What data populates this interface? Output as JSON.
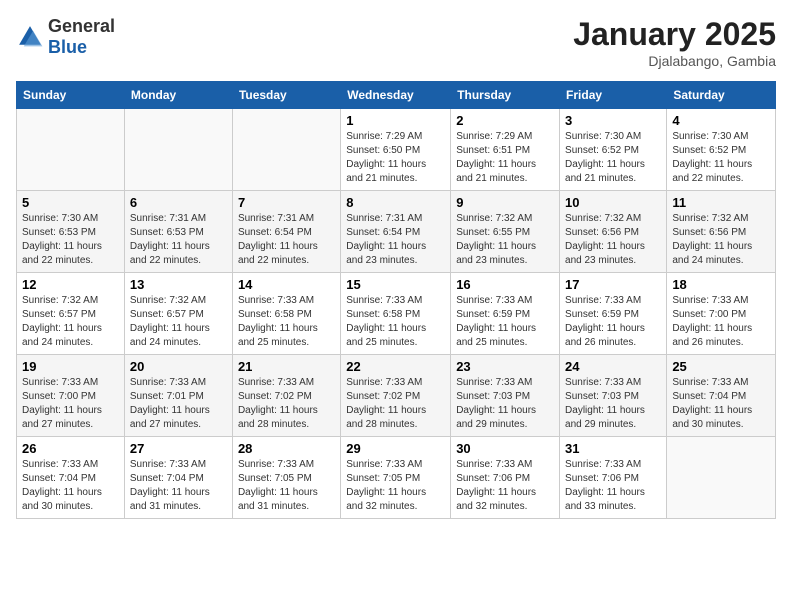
{
  "header": {
    "logo_general": "General",
    "logo_blue": "Blue",
    "month_title": "January 2025",
    "location": "Djalabango, Gambia"
  },
  "weekdays": [
    "Sunday",
    "Monday",
    "Tuesday",
    "Wednesday",
    "Thursday",
    "Friday",
    "Saturday"
  ],
  "weeks": [
    [
      {
        "day": "",
        "info": ""
      },
      {
        "day": "",
        "info": ""
      },
      {
        "day": "",
        "info": ""
      },
      {
        "day": "1",
        "info": "Sunrise: 7:29 AM\nSunset: 6:50 PM\nDaylight: 11 hours and 21 minutes."
      },
      {
        "day": "2",
        "info": "Sunrise: 7:29 AM\nSunset: 6:51 PM\nDaylight: 11 hours and 21 minutes."
      },
      {
        "day": "3",
        "info": "Sunrise: 7:30 AM\nSunset: 6:52 PM\nDaylight: 11 hours and 21 minutes."
      },
      {
        "day": "4",
        "info": "Sunrise: 7:30 AM\nSunset: 6:52 PM\nDaylight: 11 hours and 22 minutes."
      }
    ],
    [
      {
        "day": "5",
        "info": "Sunrise: 7:30 AM\nSunset: 6:53 PM\nDaylight: 11 hours and 22 minutes."
      },
      {
        "day": "6",
        "info": "Sunrise: 7:31 AM\nSunset: 6:53 PM\nDaylight: 11 hours and 22 minutes."
      },
      {
        "day": "7",
        "info": "Sunrise: 7:31 AM\nSunset: 6:54 PM\nDaylight: 11 hours and 22 minutes."
      },
      {
        "day": "8",
        "info": "Sunrise: 7:31 AM\nSunset: 6:54 PM\nDaylight: 11 hours and 23 minutes."
      },
      {
        "day": "9",
        "info": "Sunrise: 7:32 AM\nSunset: 6:55 PM\nDaylight: 11 hours and 23 minutes."
      },
      {
        "day": "10",
        "info": "Sunrise: 7:32 AM\nSunset: 6:56 PM\nDaylight: 11 hours and 23 minutes."
      },
      {
        "day": "11",
        "info": "Sunrise: 7:32 AM\nSunset: 6:56 PM\nDaylight: 11 hours and 24 minutes."
      }
    ],
    [
      {
        "day": "12",
        "info": "Sunrise: 7:32 AM\nSunset: 6:57 PM\nDaylight: 11 hours and 24 minutes."
      },
      {
        "day": "13",
        "info": "Sunrise: 7:32 AM\nSunset: 6:57 PM\nDaylight: 11 hours and 24 minutes."
      },
      {
        "day": "14",
        "info": "Sunrise: 7:33 AM\nSunset: 6:58 PM\nDaylight: 11 hours and 25 minutes."
      },
      {
        "day": "15",
        "info": "Sunrise: 7:33 AM\nSunset: 6:58 PM\nDaylight: 11 hours and 25 minutes."
      },
      {
        "day": "16",
        "info": "Sunrise: 7:33 AM\nSunset: 6:59 PM\nDaylight: 11 hours and 25 minutes."
      },
      {
        "day": "17",
        "info": "Sunrise: 7:33 AM\nSunset: 6:59 PM\nDaylight: 11 hours and 26 minutes."
      },
      {
        "day": "18",
        "info": "Sunrise: 7:33 AM\nSunset: 7:00 PM\nDaylight: 11 hours and 26 minutes."
      }
    ],
    [
      {
        "day": "19",
        "info": "Sunrise: 7:33 AM\nSunset: 7:00 PM\nDaylight: 11 hours and 27 minutes."
      },
      {
        "day": "20",
        "info": "Sunrise: 7:33 AM\nSunset: 7:01 PM\nDaylight: 11 hours and 27 minutes."
      },
      {
        "day": "21",
        "info": "Sunrise: 7:33 AM\nSunset: 7:02 PM\nDaylight: 11 hours and 28 minutes."
      },
      {
        "day": "22",
        "info": "Sunrise: 7:33 AM\nSunset: 7:02 PM\nDaylight: 11 hours and 28 minutes."
      },
      {
        "day": "23",
        "info": "Sunrise: 7:33 AM\nSunset: 7:03 PM\nDaylight: 11 hours and 29 minutes."
      },
      {
        "day": "24",
        "info": "Sunrise: 7:33 AM\nSunset: 7:03 PM\nDaylight: 11 hours and 29 minutes."
      },
      {
        "day": "25",
        "info": "Sunrise: 7:33 AM\nSunset: 7:04 PM\nDaylight: 11 hours and 30 minutes."
      }
    ],
    [
      {
        "day": "26",
        "info": "Sunrise: 7:33 AM\nSunset: 7:04 PM\nDaylight: 11 hours and 30 minutes."
      },
      {
        "day": "27",
        "info": "Sunrise: 7:33 AM\nSunset: 7:04 PM\nDaylight: 11 hours and 31 minutes."
      },
      {
        "day": "28",
        "info": "Sunrise: 7:33 AM\nSunset: 7:05 PM\nDaylight: 11 hours and 31 minutes."
      },
      {
        "day": "29",
        "info": "Sunrise: 7:33 AM\nSunset: 7:05 PM\nDaylight: 11 hours and 32 minutes."
      },
      {
        "day": "30",
        "info": "Sunrise: 7:33 AM\nSunset: 7:06 PM\nDaylight: 11 hours and 32 minutes."
      },
      {
        "day": "31",
        "info": "Sunrise: 7:33 AM\nSunset: 7:06 PM\nDaylight: 11 hours and 33 minutes."
      },
      {
        "day": "",
        "info": ""
      }
    ]
  ]
}
